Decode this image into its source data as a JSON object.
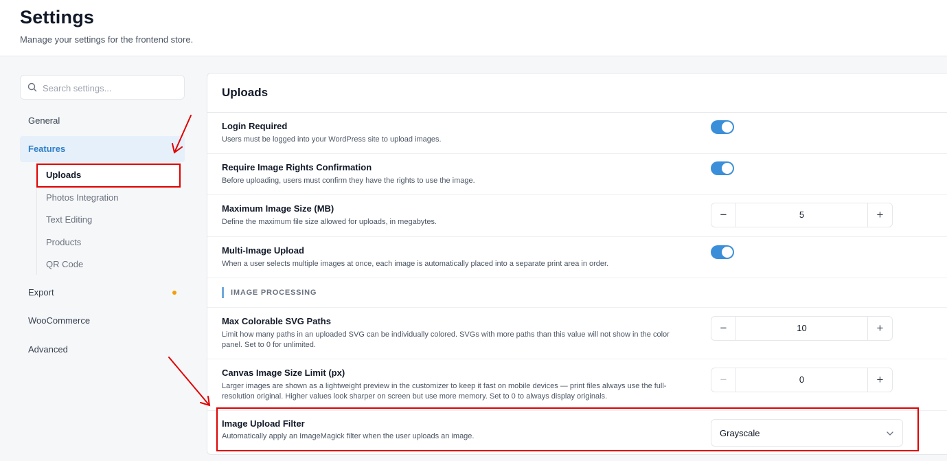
{
  "header": {
    "title": "Settings",
    "subtitle": "Manage your settings for the frontend store."
  },
  "search": {
    "placeholder": "Search settings..."
  },
  "sidebar": {
    "items": [
      {
        "label": "General"
      },
      {
        "label": "Features"
      },
      {
        "label": "Export"
      },
      {
        "label": "WooCommerce"
      },
      {
        "label": "Advanced"
      }
    ],
    "subitems": [
      {
        "label": "Uploads"
      },
      {
        "label": "Photos Integration"
      },
      {
        "label": "Text Editing"
      },
      {
        "label": "Products"
      },
      {
        "label": "QR Code"
      }
    ]
  },
  "panel": {
    "title": "Uploads",
    "settings": [
      {
        "label": "Login Required",
        "description": "Users must be logged into your WordPress site to upload images.",
        "control": "toggle",
        "enabled": true
      },
      {
        "label": "Require Image Rights Confirmation",
        "description": "Before uploading, users must confirm they have the rights to use the image.",
        "control": "toggle",
        "enabled": true
      },
      {
        "label": "Maximum Image Size (MB)",
        "description": "Define the maximum file size allowed for uploads, in megabytes.",
        "control": "stepper",
        "value": "5"
      },
      {
        "label": "Multi-Image Upload",
        "description": "When a user selects multiple images at once, each image is automatically placed into a separate print area in order.",
        "control": "toggle",
        "enabled": true
      }
    ],
    "section_title": "IMAGE PROCESSING",
    "processing": [
      {
        "label": "Max Colorable SVG Paths",
        "description": "Limit how many paths in an uploaded SVG can be individually colored. SVGs with more paths than this value will not show in the color panel. Set to 0 for unlimited.",
        "control": "stepper",
        "value": "10"
      },
      {
        "label": "Canvas Image Size Limit (px)",
        "description": "Larger images are shown as a lightweight preview in the customizer to keep it fast on mobile devices — print files always use the full-resolution original. Higher values look sharper on screen but use more memory. Set to 0 to always display originals.",
        "control": "stepper",
        "value": "0"
      },
      {
        "label": "Image Upload Filter",
        "description": "Automatically apply an ImageMagick filter when the user uploads an image.",
        "control": "select",
        "value": "Grayscale"
      }
    ]
  },
  "stepper_symbols": {
    "minus": "−",
    "plus": "+"
  },
  "colors": {
    "accent": "#3b8fd9",
    "active_nav_text": "#2f80c7",
    "active_nav_bg": "#e6f0fb",
    "annotation": "#e00000",
    "notification_dot": "#f59e0b"
  }
}
